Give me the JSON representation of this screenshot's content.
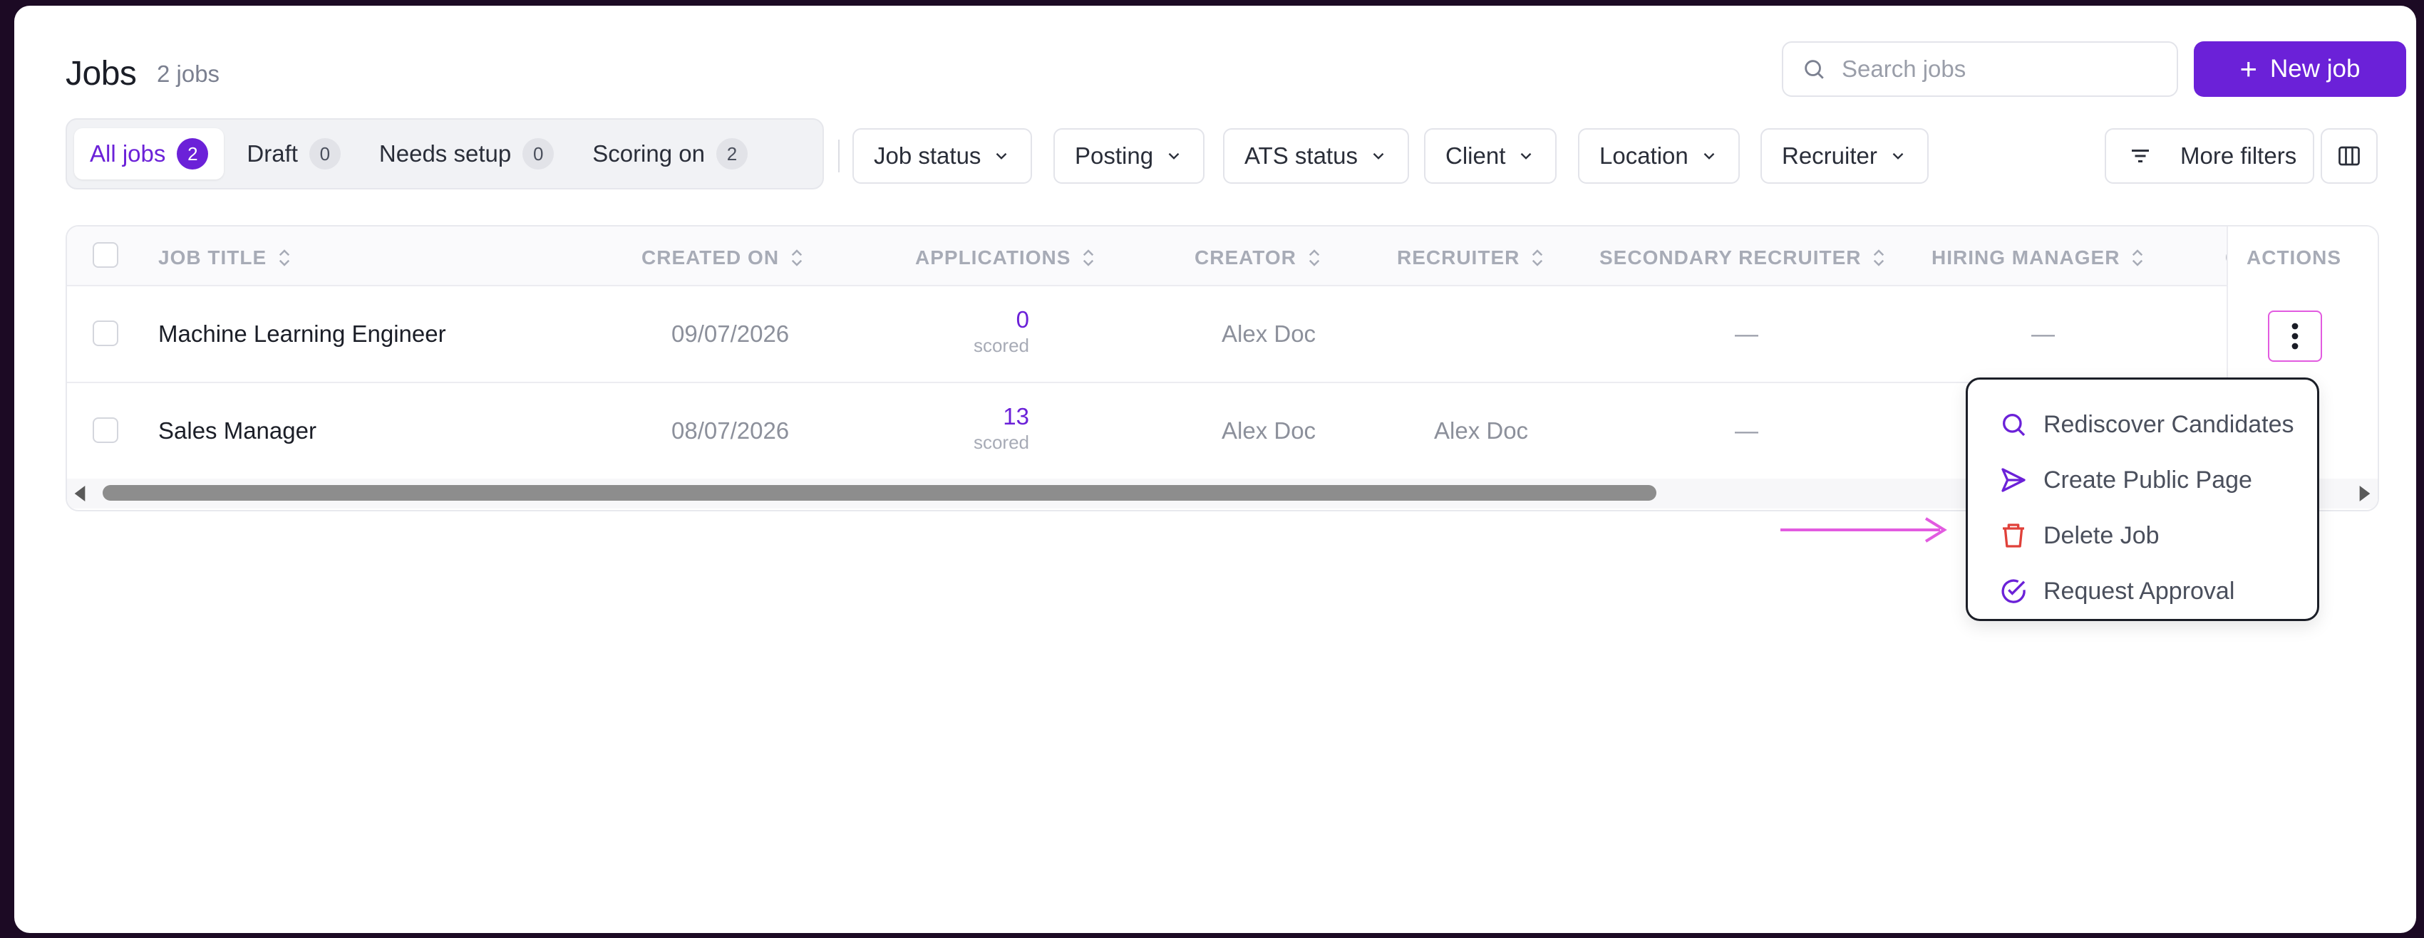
{
  "header": {
    "title": "Jobs",
    "count": "2 jobs",
    "search_placeholder": "Search jobs",
    "new_job_label": "New job"
  },
  "tabs": [
    {
      "label": "All jobs",
      "count": "2"
    },
    {
      "label": "Draft",
      "count": "0"
    },
    {
      "label": "Needs setup",
      "count": "0"
    },
    {
      "label": "Scoring on",
      "count": "2"
    }
  ],
  "filters": [
    "Job status",
    "Posting",
    "ATS status",
    "Client",
    "Location",
    "Recruiter"
  ],
  "more_filters_label": "More filters",
  "table": {
    "columns": [
      "JOB TITLE",
      "CREATED ON",
      "APPLICATIONS",
      "CREATOR",
      "RECRUITER",
      "SECONDARY RECRUITER",
      "HIRING MANAGER",
      "C",
      "ACTIONS"
    ],
    "rows": [
      {
        "title": "Machine Learning Engineer",
        "created": "09/07/2026",
        "applications": "0",
        "applications_label": "scored",
        "creator": "Alex Doc",
        "recruiter": "",
        "secondary_recruiter": "—",
        "hiring_manager": "—"
      },
      {
        "title": "Sales Manager",
        "created": "08/07/2026",
        "applications": "13",
        "applications_label": "scored",
        "creator": "Alex Doc",
        "recruiter": "Alex Doc",
        "secondary_recruiter": "—",
        "hiring_manager": ""
      }
    ]
  },
  "menu": [
    {
      "label": "Rediscover Candidates",
      "icon": "search-icon",
      "color": "#6b21d8"
    },
    {
      "label": "Create Public Page",
      "icon": "send-icon",
      "color": "#6b21d8"
    },
    {
      "label": "Delete Job",
      "icon": "trash-icon",
      "color": "#e0413a"
    },
    {
      "label": "Request Approval",
      "icon": "check-circle-icon",
      "color": "#6b21d8"
    }
  ],
  "colors": {
    "accent": "#6b21d8",
    "danger": "#e0413a",
    "highlight": "#e25be0"
  }
}
